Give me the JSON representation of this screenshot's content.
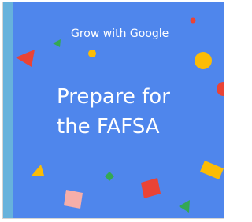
{
  "brand": {
    "text": "Grow with Google"
  },
  "title": {
    "text": "Prepare for\nthe FAFSA"
  },
  "colors": {
    "background": "#4f86ec",
    "stripe": "#67b2dc",
    "red": "#ea4335",
    "yellow": "#fbbc05",
    "green": "#34a853",
    "pink": "#f6aea9"
  },
  "decorations": [
    "red-triangle-icon",
    "green-triangle-icon",
    "yellow-dot-icon",
    "red-dot-icon",
    "yellow-circle-icon",
    "red-circle-icon",
    "yellow-triangle-icon",
    "green-dot-icon",
    "pink-square-icon",
    "red-square-icon",
    "green-triangle-icon",
    "yellow-square-icon"
  ]
}
